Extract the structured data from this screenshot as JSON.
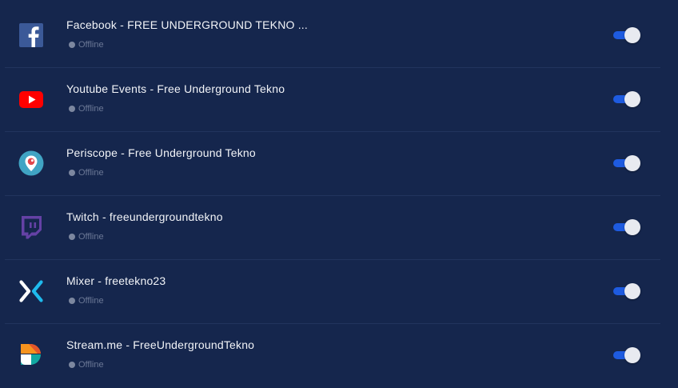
{
  "destinations": [
    {
      "platform": "Facebook",
      "icon": "facebook-icon",
      "title": "Facebook - FREE UNDERGROUND TEKNO ...",
      "status": "Offline",
      "enabled": true
    },
    {
      "platform": "Youtube",
      "icon": "youtube-icon",
      "title": "Youtube Events - Free Underground Tekno",
      "status": "Offline",
      "enabled": true
    },
    {
      "platform": "Periscope",
      "icon": "periscope-icon",
      "title": "Periscope - Free Underground Tekno",
      "status": "Offline",
      "enabled": true
    },
    {
      "platform": "Twitch",
      "icon": "twitch-icon",
      "title": "Twitch - freeundergroundtekno",
      "status": "Offline",
      "enabled": true
    },
    {
      "platform": "Mixer",
      "icon": "mixer-icon",
      "title": "Mixer - freetekno23",
      "status": "Offline",
      "enabled": true
    },
    {
      "platform": "Stream.me",
      "icon": "streamme-icon",
      "title": "Stream.me - FreeUndergroundTekno",
      "status": "Offline",
      "enabled": true
    }
  ],
  "colors": {
    "background": "#15264d",
    "toggle_on": "#1e5be0",
    "status_dot": "#7c879f"
  }
}
